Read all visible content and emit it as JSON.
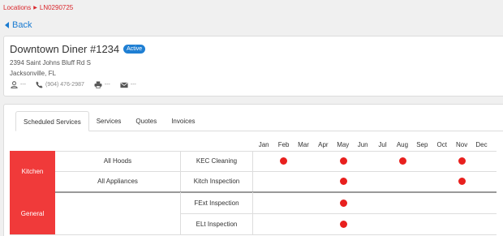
{
  "breadcrumb": {
    "root": "Locations",
    "current": "LN0290725"
  },
  "back": {
    "label": "Back"
  },
  "location": {
    "name": "Downtown Diner #1234",
    "status": "Active",
    "address_line1": "2394 Saint Johns Bluff Rd S",
    "address_line2": "Jacksonville, FL",
    "contact_person": "---",
    "phone": "(904) 476-2987",
    "fax": "---",
    "email": "---"
  },
  "tabs": [
    {
      "label": "Scheduled Services",
      "active": true
    },
    {
      "label": "Services",
      "active": false
    },
    {
      "label": "Quotes",
      "active": false
    },
    {
      "label": "Invoices",
      "active": false
    }
  ],
  "months": [
    "Jan",
    "Feb",
    "Mar",
    "Apr",
    "May",
    "Jun",
    "Jul",
    "Aug",
    "Sep",
    "Oct",
    "Nov",
    "Dec"
  ],
  "schedule": {
    "groups": [
      {
        "name": "Kitchen",
        "rows": [
          {
            "area": "All Hoods",
            "service": "KEC Cleaning",
            "months": [
              "Feb",
              "May",
              "Aug",
              "Nov"
            ]
          },
          {
            "area": "All Appliances",
            "service": "Kitch Inspection",
            "months": [
              "May",
              "Nov"
            ]
          }
        ]
      },
      {
        "name": "General",
        "rows": [
          {
            "area": "",
            "service": "FExt Inspection",
            "months": [
              "May"
            ]
          },
          {
            "area": "",
            "service": "ELt Inspection",
            "months": [
              "May"
            ]
          }
        ]
      }
    ]
  },
  "colors": {
    "accent": "#1f7fd3",
    "group_bg": "#f03a3a",
    "dot": "#e8201e",
    "breadcrumb": "#d9262b"
  }
}
